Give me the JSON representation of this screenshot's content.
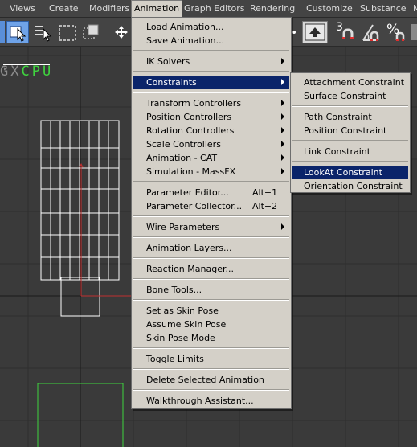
{
  "menubar": {
    "items": [
      "Views",
      "Create",
      "Modifiers",
      "Animation",
      "Graph Editors",
      "Rendering",
      "Customize",
      "Substance",
      "M"
    ],
    "active": "Animation"
  },
  "toolbar": {
    "snap_label": "3",
    "percent_label": "%"
  },
  "viewport": {
    "label_grey": "GX",
    "label_green": "CPU"
  },
  "animation_menu": {
    "load_animation": "Load Animation...",
    "save_animation": "Save Animation...",
    "ik_solvers": "IK Solvers",
    "constraints": "Constraints",
    "transform_controllers": "Transform Controllers",
    "position_controllers": "Position Controllers",
    "rotation_controllers": "Rotation Controllers",
    "scale_controllers": "Scale Controllers",
    "animation_cat": "Animation - CAT",
    "simulation_massfx": "Simulation - MassFX",
    "parameter_editor": "Parameter Editor...",
    "parameter_editor_shortcut": "Alt+1",
    "parameter_collector": "Parameter Collector...",
    "parameter_collector_shortcut": "Alt+2",
    "wire_parameters": "Wire Parameters",
    "animation_layers": "Animation Layers...",
    "reaction_manager": "Reaction Manager...",
    "bone_tools": "Bone Tools...",
    "set_as_skin_pose": "Set as Skin Pose",
    "assume_skin_pose": "Assume Skin Pose",
    "skin_pose_mode": "Skin Pose Mode",
    "toggle_limits": "Toggle Limits",
    "delete_selected_animation": "Delete Selected Animation",
    "walkthrough_assistant": "Walkthrough Assistant..."
  },
  "constraints_submenu": {
    "attachment": "Attachment Constraint",
    "surface": "Surface Constraint",
    "path": "Path Constraint",
    "position": "Position Constraint",
    "link": "Link Constraint",
    "lookat": "LookAt Constraint",
    "orientation": "Orientation Constraint"
  },
  "colors": {
    "menu_bg": "#d4d0c8",
    "highlight": "#0a246a",
    "viewport_bg": "#3a3a3a",
    "wire_white": "#ffffff",
    "wire_green": "#3fd43f",
    "gizmo_red": "#c03030"
  }
}
